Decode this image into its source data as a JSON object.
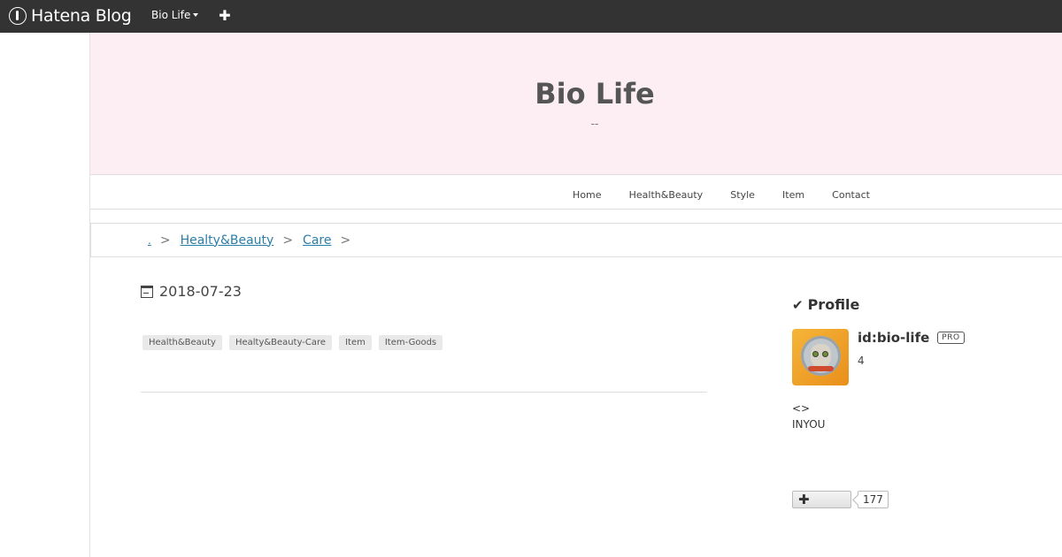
{
  "topbar": {
    "brand": "Hatena Blog",
    "blog_switch": "Bio Life",
    "add_icon": "plus-icon"
  },
  "header": {
    "title": "Bio Life",
    "description": "--"
  },
  "nav": {
    "items": [
      "Home",
      "Health&Beauty",
      "Style",
      "Item",
      "Contact"
    ]
  },
  "breadcrumb": {
    "root": ".",
    "items": [
      "Healty&Beauty",
      "Care"
    ],
    "separator": ">"
  },
  "article": {
    "date": "2018-07-23",
    "tags": [
      "Health&Beauty",
      "Healty&Beauty-Care",
      "Item",
      "Item-Goods"
    ]
  },
  "sidebar": {
    "profile_title": "Profile",
    "user_id": "id:bio-life",
    "pro_badge": "PRO",
    "count": "4",
    "line1": "<>",
    "line2": "INYOU",
    "subscribe_count": "177"
  },
  "colors": {
    "topbar_bg": "#333333",
    "header_bg": "#fdeef3",
    "link": "#2b7ea8"
  }
}
